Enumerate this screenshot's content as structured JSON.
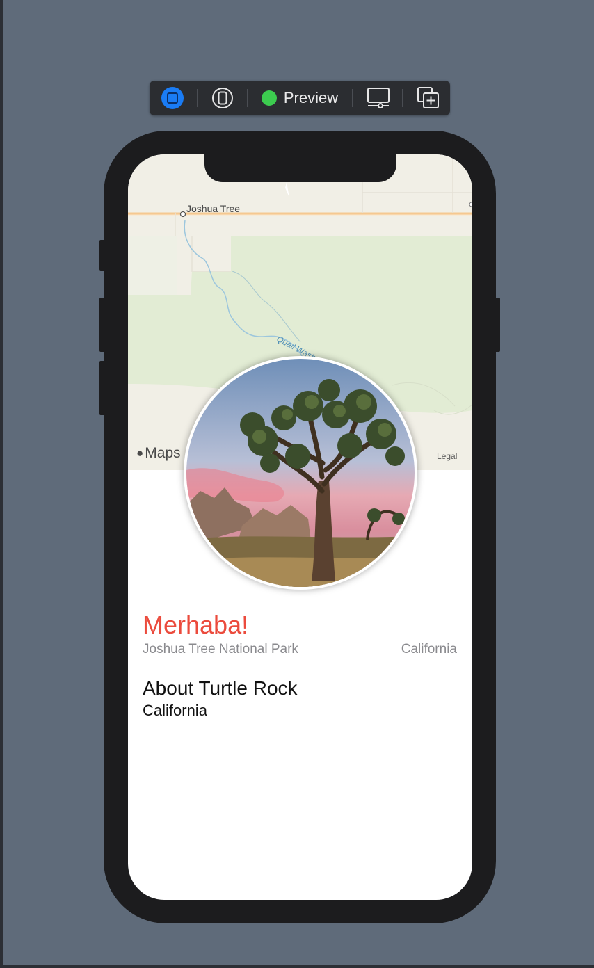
{
  "toolbar": {
    "live_icon": "live-preview-stop-icon",
    "device_icon": "device-settings-icon",
    "preview_label": "Preview",
    "display_icon": "display-preview-icon",
    "duplicate_icon": "duplicate-preview-icon"
  },
  "map": {
    "place_label": "Joshua Tree",
    "creek_label": "Quail Wash",
    "brand_label": "Maps",
    "legal_label": "Legal",
    "colors": {
      "land": "#f1efe6",
      "park": "#e2ecd4",
      "road": "#f5c890",
      "water": "#7fb6d4"
    }
  },
  "detail": {
    "title": "Merhaba!",
    "park": "Joshua Tree National Park",
    "state": "California",
    "about_heading": "About Turtle Rock",
    "about_text": "California",
    "title_color": "#eb4b3d"
  }
}
